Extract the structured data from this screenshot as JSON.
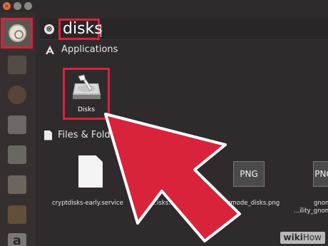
{
  "window": {
    "close_glyph": "×",
    "min_glyph": "",
    "max_glyph": ""
  },
  "launcher": {
    "items": [
      {
        "icon": "ubuntu-dash-icon"
      },
      {
        "icon": "files-icon"
      },
      {
        "icon": "firefox-icon"
      },
      {
        "icon": "writer-icon"
      },
      {
        "icon": "calc-icon"
      },
      {
        "icon": "impress-icon"
      },
      {
        "icon": "software-center-icon"
      },
      {
        "icon": "amazon-icon"
      }
    ],
    "amazon_glyph": "a"
  },
  "search": {
    "clear_glyph": "⊗",
    "query": "disks"
  },
  "applications": {
    "header": "Applications",
    "items": [
      {
        "label": "Disks",
        "icon": "disks-app-icon"
      }
    ]
  },
  "files": {
    "header": "Files & Folde",
    "items": [
      {
        "label": "cryptdisks-early.service",
        "icon": "document-icon"
      },
      {
        "label": "...isks...",
        "icon": "document-icon"
      },
      {
        "label": "usermode_disks.png",
        "icon": "png-file-icon",
        "thumb": "PNG"
      },
      {
        "label": "gnom",
        "label2": "...ility_gnom",
        "icon": "png-file-icon",
        "thumb": "PNG"
      }
    ]
  },
  "watermark": {
    "brand": "wiki",
    "suffix": "How"
  },
  "colors": {
    "highlight": "#d8233b",
    "background": "#2f2a2b"
  }
}
